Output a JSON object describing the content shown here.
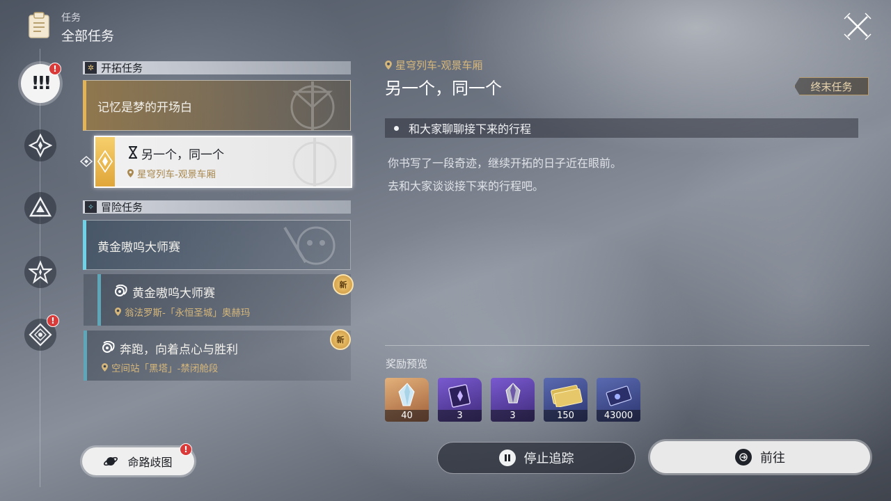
{
  "header": {
    "subtitle": "任务",
    "title": "全部任务"
  },
  "nav": {
    "main_glyph": "!!!",
    "badge": "!"
  },
  "sections": {
    "trailblaze": {
      "label": "开拓任务",
      "card_title": "记忆是梦的开场白",
      "active_quest": {
        "title": "另一个，同一个",
        "location": "星穹列车-观景车厢"
      }
    },
    "adventure": {
      "label": "冒险任务",
      "card_title": "黄金嗷呜大师赛",
      "quests": [
        {
          "title": "黄金嗷呜大师赛",
          "location": "翁法罗斯-「永恒圣城」奥赫玛",
          "badge": "新"
        },
        {
          "title": "奔跑，向着点心与胜利",
          "location": "空间站「黑塔」-禁闭舱段",
          "badge": "新"
        }
      ]
    }
  },
  "detail": {
    "location": "星穹列车-观景车厢",
    "title": "另一个，同一个",
    "tag": "终末任务",
    "objective": "和大家聊聊接下来的行程",
    "description": [
      "你书写了一段奇迹，继续开拓的日子近在眼前。",
      "去和大家谈谈接下来的行程吧。"
    ],
    "reward_label": "奖励预览",
    "rewards": [
      {
        "name": "crystal-icon",
        "qty": "40",
        "color": "#c9885a"
      },
      {
        "name": "purple-book-icon",
        "qty": "3",
        "color": "#5a3f9e"
      },
      {
        "name": "purple-ore-icon",
        "qty": "3",
        "color": "#5a3f9e"
      },
      {
        "name": "credit-icon",
        "qty": "150",
        "color": "#3f4f8e"
      },
      {
        "name": "exp-card-icon",
        "qty": "43000",
        "color": "#3f4f8e"
      }
    ]
  },
  "buttons": {
    "stop": "停止追踪",
    "go": "前往",
    "map": "命路歧图",
    "map_badge": "!"
  }
}
